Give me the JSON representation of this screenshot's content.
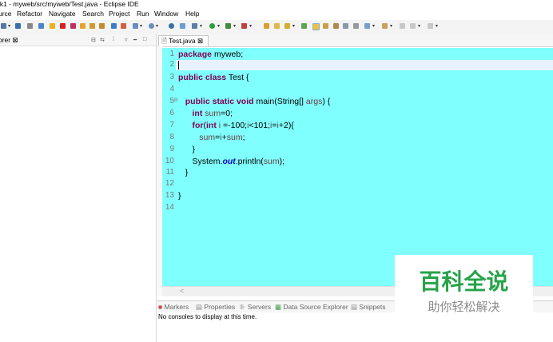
{
  "window": {
    "title": "rk1 - myweb/src/myweb/Test.java - Eclipse IDE"
  },
  "menu": {
    "items": [
      "urce",
      "Refactor",
      "Navigate",
      "Search",
      "Project",
      "Run",
      "Window",
      "Help"
    ]
  },
  "explorer": {
    "title": "orer ⊠"
  },
  "editor": {
    "tab_label": "Test.java ⊠",
    "line_numbers": [
      "1",
      "2",
      "3",
      "4",
      "5",
      "6",
      "7",
      "8",
      "9",
      "10",
      "11",
      "12",
      "13",
      "14"
    ],
    "scroll_hint": "<"
  },
  "console": {
    "tabs": [
      "Markers",
      "Properties",
      "Servers",
      "Data Source Explorer",
      "Snippets"
    ],
    "message": "No consoles to display at this time."
  },
  "watermark": {
    "title": "百科全说",
    "subtitle": "助你轻松解决"
  }
}
